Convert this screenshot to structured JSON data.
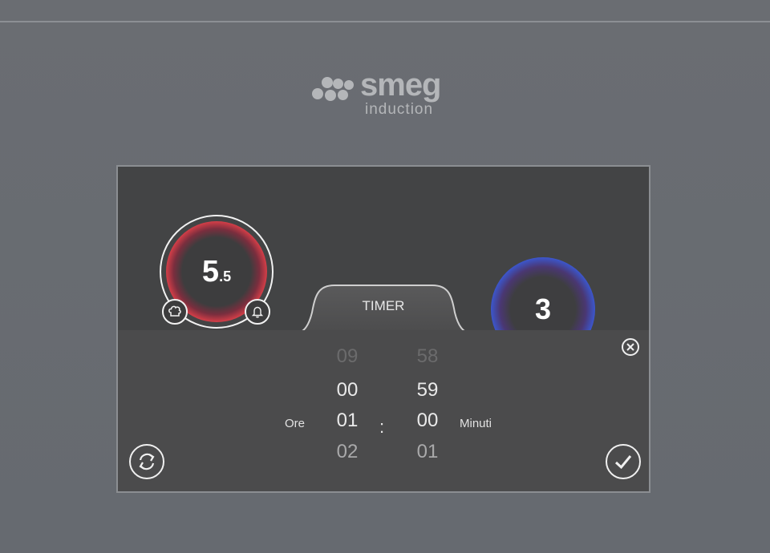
{
  "brand": {
    "name": "smeg",
    "subtitle": "induction"
  },
  "zones": {
    "left": {
      "level_main": "5",
      "level_sub": ".5",
      "accent": "#f06d46"
    },
    "right": {
      "level": "3",
      "accent": "#3c55c8"
    }
  },
  "icons": {
    "left_top_mini": "chef-hat-icon",
    "left_right_mini": "bell-icon",
    "close": "close-icon",
    "reset": "refresh-icon",
    "confirm": "checkmark-icon"
  },
  "timer": {
    "tab_label": "TIMER",
    "hours_label": "Ore",
    "minutes_label": "Minuti",
    "separator": ":",
    "hours": [
      "09",
      "00",
      "01",
      "02"
    ],
    "minutes": [
      "58",
      "59",
      "00",
      "01"
    ],
    "selected_hours": "01",
    "selected_minutes": "00"
  }
}
